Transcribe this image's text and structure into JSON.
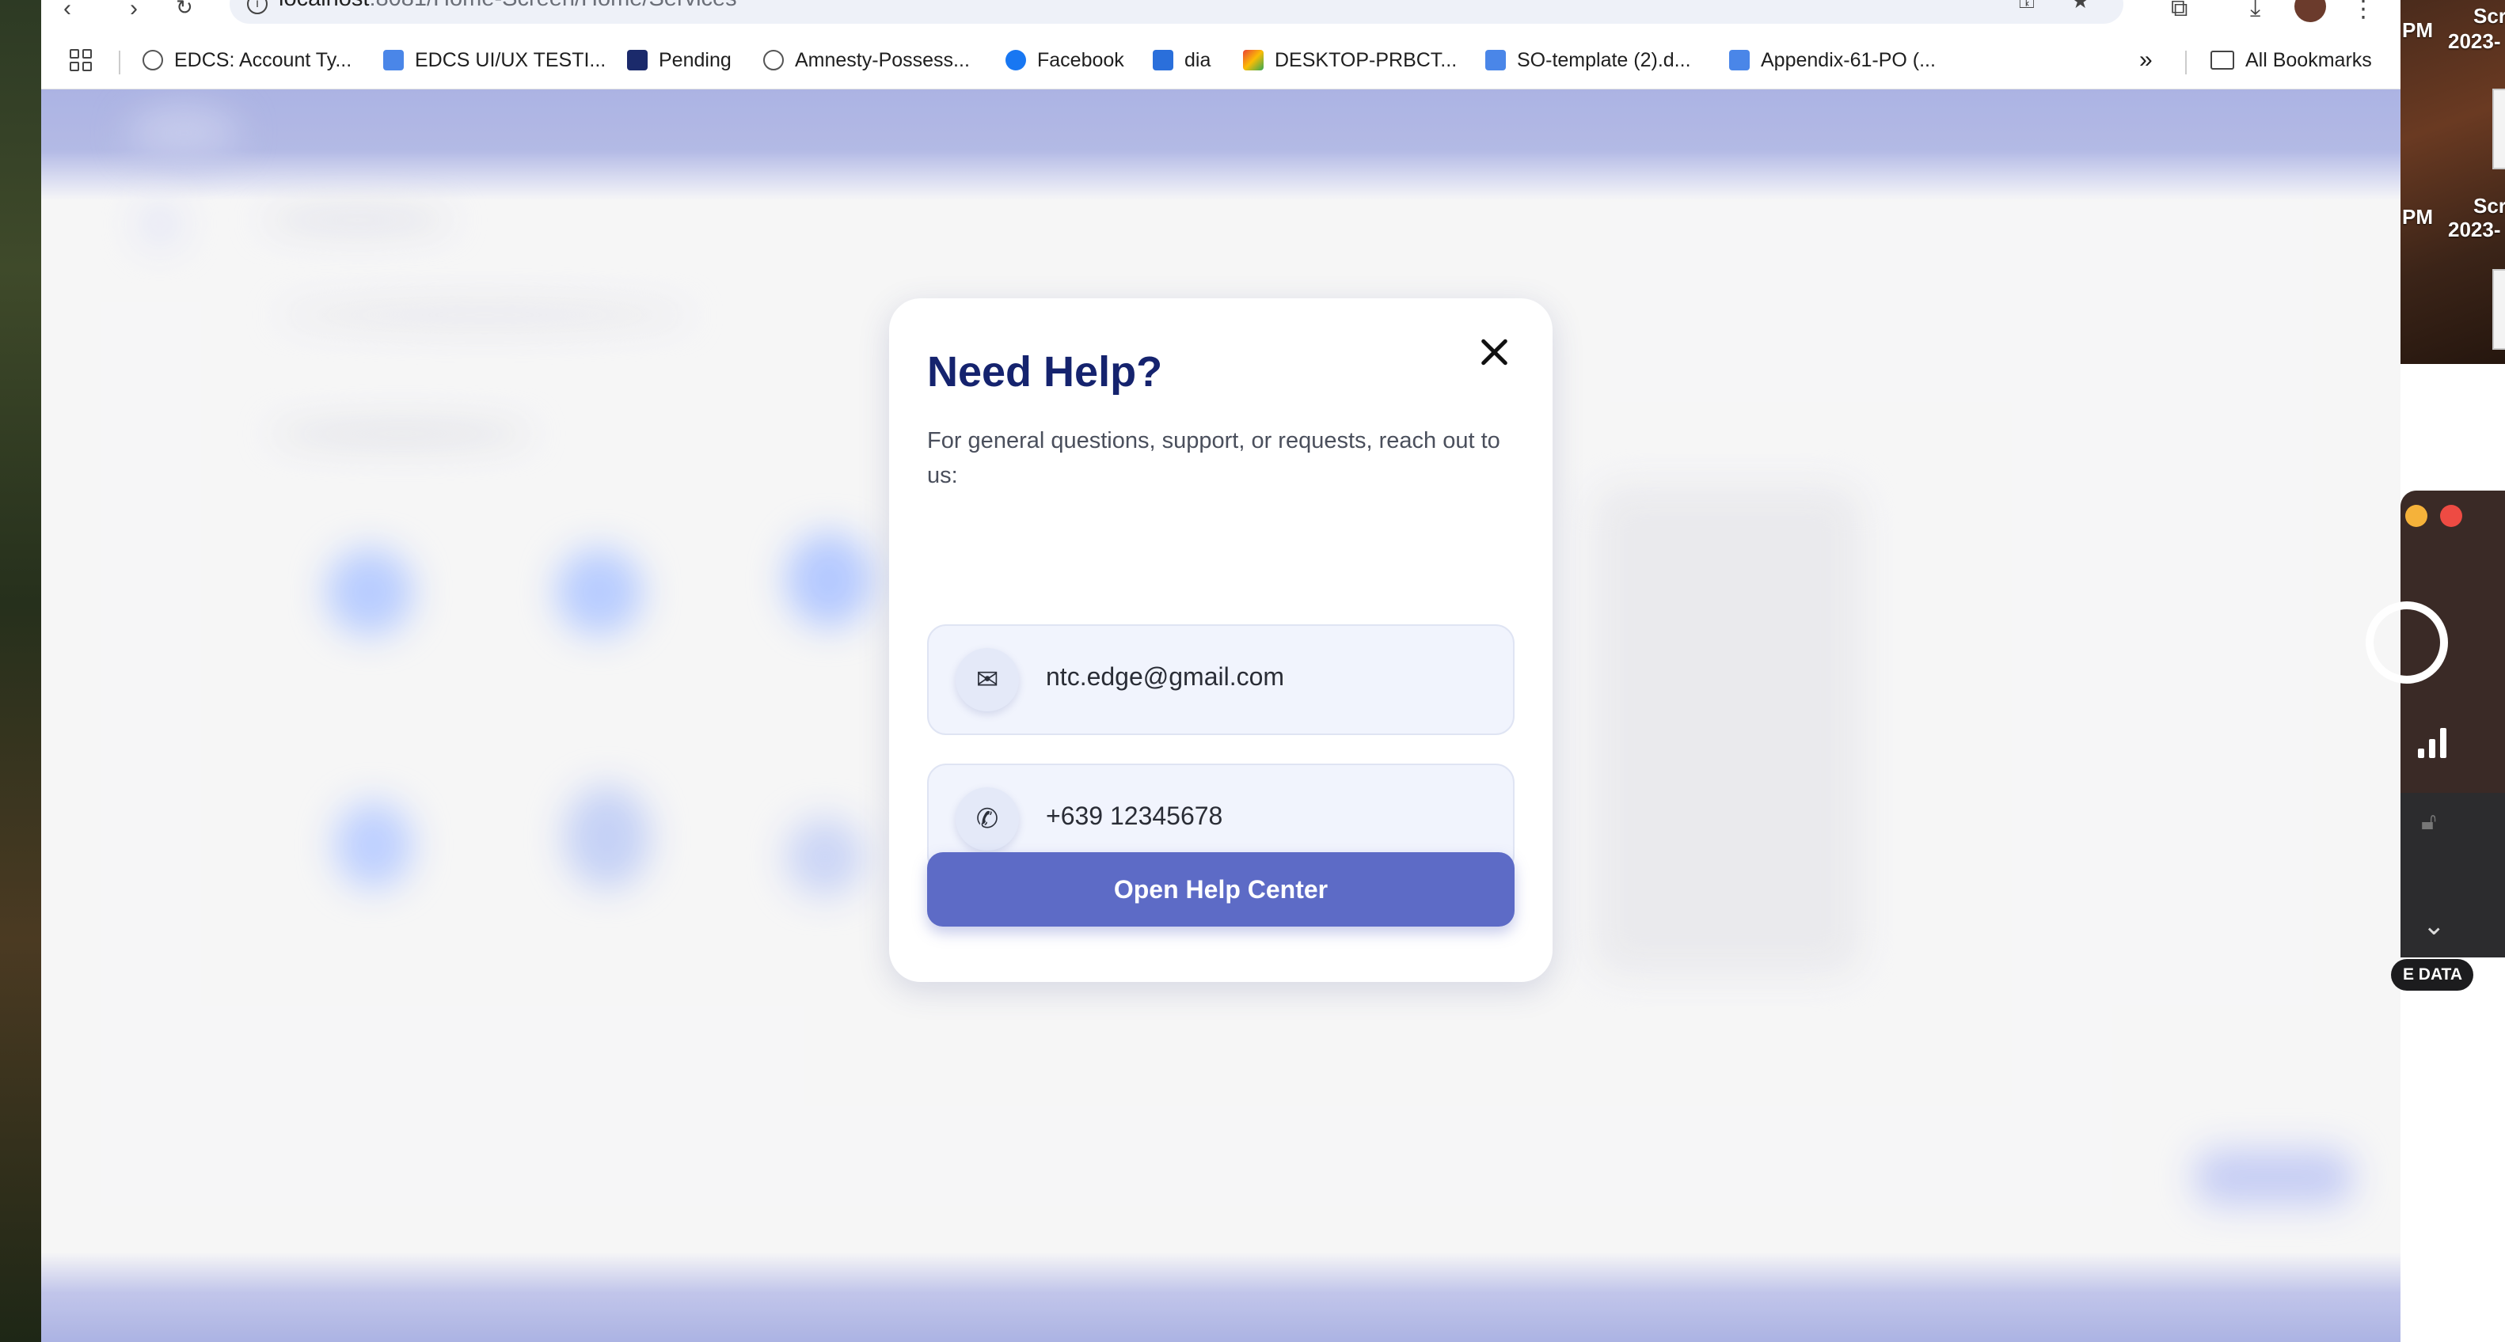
{
  "desktop": {
    "labels": [
      "PM",
      "Scr",
      "2023-",
      "PM",
      "Scr",
      "2023-"
    ]
  },
  "browser": {
    "url_host": "localhost",
    "url_rest": ":8081/Home-Screen/Home/Services",
    "bookmarks": [
      {
        "label": "EDCS: Account Ty...",
        "icon": "globe-icon"
      },
      {
        "label": "EDCS UI/UX TESTI...",
        "icon": "doc-icon"
      },
      {
        "label": "Pending",
        "icon": "app-icon"
      },
      {
        "label": "Amnesty-Possess...",
        "icon": "globe-icon"
      },
      {
        "label": "Facebook",
        "icon": "facebook-icon"
      },
      {
        "label": "dia",
        "icon": "dia-icon"
      },
      {
        "label": "DESKTOP-PRBCT...",
        "icon": "gmail-icon"
      },
      {
        "label": "SO-template (2).d...",
        "icon": "doc-icon"
      },
      {
        "label": "Appendix-61-PO (...",
        "icon": "doc-icon"
      }
    ],
    "more_bookmarks": "»",
    "all_bookmarks": "All Bookmarks"
  },
  "modal": {
    "title": "Need Help?",
    "description": "For general questions, support, or requests, reach out to us:",
    "email": "ntc.edge@gmail.com",
    "phone": "+639 12345678",
    "button_label": "Open Help Center"
  },
  "widget": {
    "pill_label": "E DATA"
  },
  "colors": {
    "accent": "#5d6bc6",
    "title": "#15236e",
    "header_band": "#9aa3dd"
  }
}
